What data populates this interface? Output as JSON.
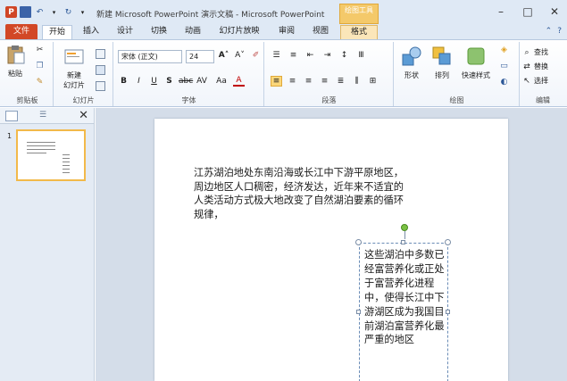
{
  "titlebar": {
    "title": "新建 Microsoft PowerPoint 演示文稿 - Microsoft PowerPoint",
    "context_tab_title": "绘图工具",
    "app_icon": "P"
  },
  "tabs": [
    "文件",
    "开始",
    "插入",
    "设计",
    "切换",
    "动画",
    "幻灯片放映",
    "审阅",
    "视图",
    "格式"
  ],
  "ribbon": {
    "clipboard": {
      "paste": "粘贴",
      "label": "剪贴板"
    },
    "slides": {
      "new_slide_line1": "新建",
      "new_slide_line2": "幻灯片",
      "label": "幻灯片"
    },
    "font": {
      "font_name": "宋体 (正文)",
      "font_size": "24",
      "label": "字体"
    },
    "paragraph": {
      "label": "段落"
    },
    "drawing": {
      "shapes": "形状",
      "arrange": "排列",
      "quick_styles": "快速样式",
      "label": "绘图"
    },
    "editing": {
      "find": "查找",
      "replace": "替换",
      "select": "选择",
      "label": "编辑"
    }
  },
  "slide_panel": {
    "slide_number": "1"
  },
  "slide": {
    "textbox1": "江苏湖泊地处东南沿海或长江中下游平原地区，周边地区人口稠密，经济发达，近年来不适宜的人类活动方式极大地改变了自然湖泊要素的循环规律，",
    "textbox2": "这些湖泊中多数已经富营养化或正处于富营养化进程中，使得长江中下游湖区成为我国目前湖泊富营养化最严重的地区"
  },
  "colors": {
    "file_tab": "#d24726",
    "context_tab": "#f4c96a",
    "selection_handle": "#7ac143"
  }
}
